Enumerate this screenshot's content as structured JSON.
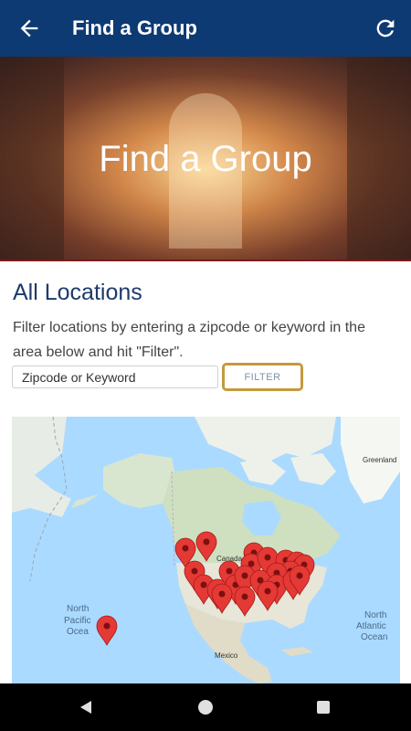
{
  "app_bar": {
    "title": "Find a Group",
    "back_icon": "arrow-left-icon",
    "refresh_icon": "refresh-icon",
    "color": "#0e3a73"
  },
  "hero": {
    "title": "Find a Group"
  },
  "main": {
    "section_title": "All Locations",
    "description": "Filter locations by entering a zipcode or keyword in the area below and hit \"Filter\".",
    "search": {
      "placeholder": "Zipcode or Keyword",
      "value": ""
    },
    "filter_button": "FILTER",
    "filter_border_color": "#c49a3c"
  },
  "map": {
    "labels": {
      "greenland": "Greenland",
      "canada": "Canada",
      "north_pacific_1": "North",
      "north_pacific_2": "Pacific",
      "north_pacific_3": "Ocea",
      "north_atlantic_1": "North",
      "north_atlantic_2": "Atlantic",
      "north_atlantic_3": "Ocean",
      "mexico": "Mexico"
    },
    "pin_color": "#e53935"
  },
  "nav_bar": {
    "back_icon": "triangle-back-icon",
    "home_icon": "circle-home-icon",
    "recents_icon": "square-recents-icon"
  }
}
